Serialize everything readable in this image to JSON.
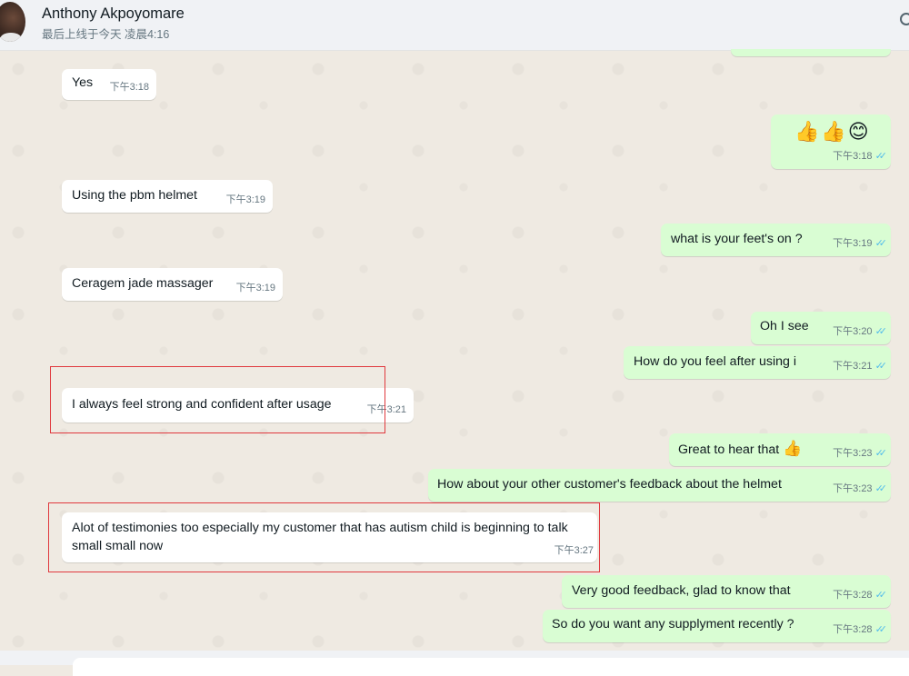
{
  "header": {
    "contact_name": "Anthony Akpoyomare",
    "last_seen": "最后上线于今天 凌晨4:16"
  },
  "messages": [
    {
      "dir": "in",
      "text": "Yes",
      "time": "下午3:18"
    },
    {
      "dir": "out",
      "text": "👍👍😊",
      "time": "下午3:18",
      "ticks": "✓✓"
    },
    {
      "dir": "in",
      "text": "Using the pbm helmet",
      "time": "下午3:19"
    },
    {
      "dir": "out",
      "text": "what is your feet's on ?",
      "time": "下午3:19",
      "ticks": "✓✓"
    },
    {
      "dir": "in",
      "text": "Ceragem jade massager",
      "time": "下午3:19"
    },
    {
      "dir": "out",
      "text": "Oh I see",
      "time": "下午3:20",
      "ticks": "✓✓"
    },
    {
      "dir": "out",
      "text": "How do you feel after using i",
      "time": "下午3:21",
      "ticks": "✓✓"
    },
    {
      "dir": "in",
      "text": "I always feel strong and confident after usage",
      "time": "下午3:21"
    },
    {
      "dir": "out",
      "text": "Great to hear that",
      "emoji": "👍",
      "time": "下午3:23",
      "ticks": "✓✓"
    },
    {
      "dir": "out",
      "text": "How about your other customer's feedback about the helmet",
      "time": "下午3:23",
      "ticks": "✓✓"
    },
    {
      "dir": "in",
      "text": "Alot of testimonies too especially my customer that has autism child is beginning to talk small small now",
      "time": "下午3:27"
    },
    {
      "dir": "out",
      "text": "Very good feedback, glad to know that",
      "time": "下午3:28",
      "ticks": "✓✓"
    },
    {
      "dir": "out",
      "text": "So do you want any supplyment recently ?",
      "time": "下午3:28",
      "ticks": "✓✓"
    }
  ],
  "colors": {
    "incoming": "#ffffff",
    "outgoing": "#d9fdd3",
    "read_ticks": "#53bdeb",
    "highlight_box": "#e0393e"
  },
  "icons": [
    "avatar",
    "double-check-icon",
    "menu-icon"
  ]
}
